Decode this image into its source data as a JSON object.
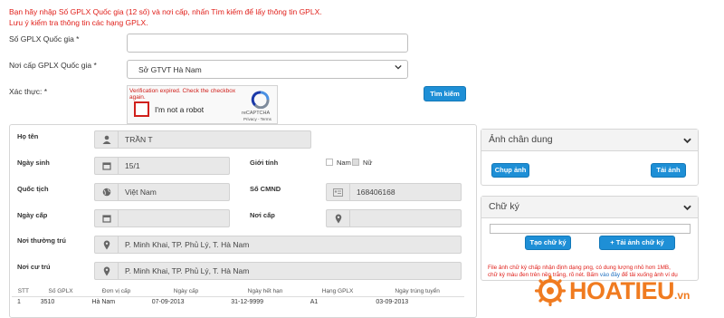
{
  "notice": {
    "line1": "Bạn hãy nhập Số GPLX Quốc gia (12 số) và nơi cấp, nhấn Tìm kiếm để lấy thông tin GPLX.",
    "line2": "Lưu ý kiểm tra thông tin các hạng GPLX."
  },
  "search": {
    "gplx_label": "Số GPLX Quốc gia *",
    "gplx_value": "",
    "noicap_label": "Nơi cấp GPLX Quốc gia *",
    "noicap_value": "Sở GTVT Hà Nam",
    "captcha_label": "Xác thực: *",
    "search_button": "Tìm kiếm"
  },
  "captcha": {
    "error": "Verification expired. Check the checkbox again.",
    "checkbox_label": "I'm not a robot",
    "brand": "reCAPTCHA",
    "terms": "Privacy - Terms"
  },
  "details": {
    "hoten_label": "Họ tên",
    "hoten_value": "TRẦN T",
    "ngaysinh_label": "Ngày sinh",
    "ngaysinh_value": "15/1",
    "gioitinh_label": "Giới tính",
    "nam_label": "Nam",
    "nu_label": "Nữ",
    "quoctich_label": "Quốc tịch",
    "quoctich_value": "Việt Nam",
    "socmnd_label": "Số CMND",
    "socmnd_value": "168406168",
    "ngaycap_label": "Ngày cấp",
    "ngaycap_value": "",
    "noicap_label": "Nơi cấp",
    "noicap_value": "",
    "thuongtru_label": "Nơi thường trú",
    "thuongtru_value": "P. Minh Khai, TP. Phủ Lý, T. Hà Nam",
    "cutru_label": "Nơi cư trú",
    "cutru_value": "P. Minh Khai, TP. Phủ Lý, T. Hà Nam"
  },
  "portrait": {
    "title": "Ảnh chân dung",
    "capture_button": "Chụp ảnh",
    "upload_button": "Tải ảnh"
  },
  "signature": {
    "title": "Chữ ký",
    "create_button": "Tạo chữ ký",
    "upload_button": "Tải ảnh chữ ký",
    "note_line1": "File ảnh chữ ký chấp nhận định dạng png, có dung lượng nhỏ hơn 1MB,",
    "note_line2": "chữ ký màu đen trên nền trắng, rõ nét. Bấm ",
    "note_link": "vào đây",
    "note_line3": " để tải xuống ảnh ví dụ"
  },
  "table": {
    "headers": [
      "STT",
      "Số GPLX",
      "Đơn vị cấp",
      "Ngày cấp",
      "Ngày hết hạn",
      "Hạng GPLX",
      "Ngày trúng tuyển"
    ],
    "rows": [
      [
        "1",
        "3510",
        "Hà Nam",
        "07-09-2013",
        "31-12-9999",
        "A1",
        "03-09-2013"
      ]
    ]
  },
  "watermark": {
    "text": "HOATIEU",
    "suffix": ".vn"
  },
  "colors": {
    "accent": "#1e8fd6",
    "error": "#e0201b",
    "watermark": "#f07b20"
  },
  "icons": [
    "user-icon",
    "calendar-icon",
    "globe-icon",
    "id-card-icon",
    "map-marker-icon",
    "chevron-down-icon",
    "recaptcha-icon",
    "helm-icon"
  ]
}
